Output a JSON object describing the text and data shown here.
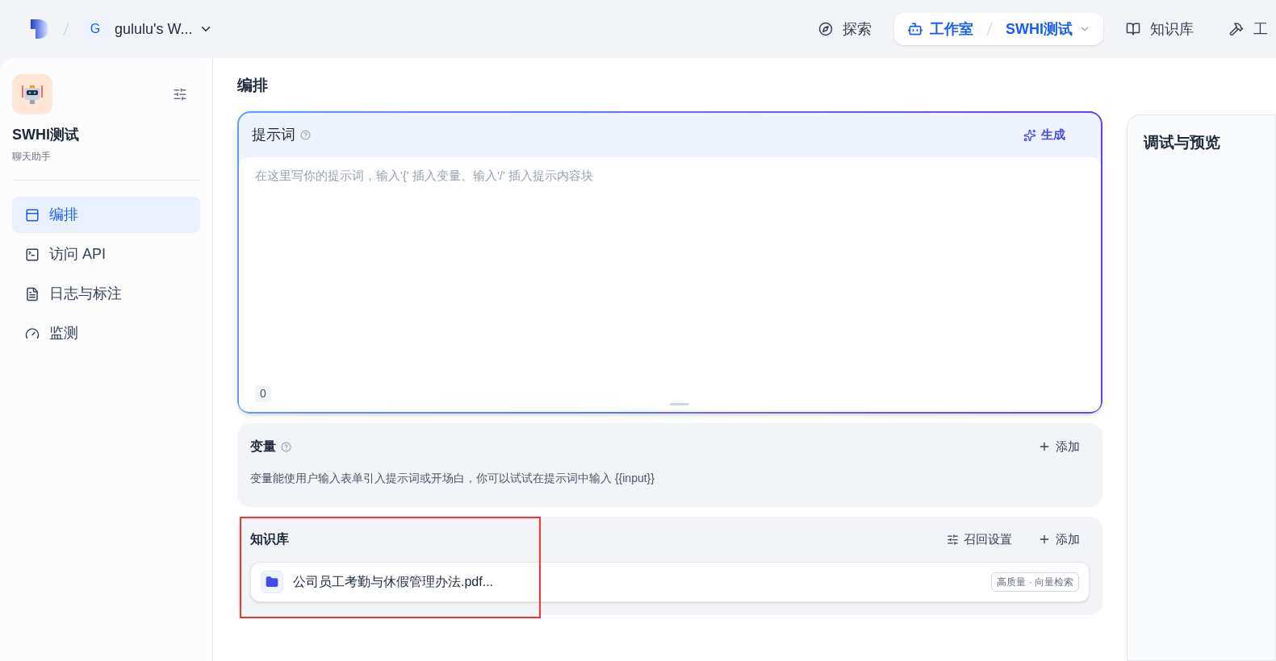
{
  "topbar": {
    "workspace_initial": "G",
    "workspace_name": "gululu's W...",
    "nav": [
      {
        "kind": "link",
        "label": "探索",
        "selected": false
      },
      {
        "kind": "crumb",
        "label": "工作室",
        "app": "SWHI测试",
        "selected": true
      },
      {
        "kind": "link",
        "label": "知识库",
        "selected": false
      },
      {
        "kind": "link",
        "label": "工",
        "selected": false
      }
    ]
  },
  "sidebar": {
    "app_name": "SWHI测试",
    "app_type": "聊天助手",
    "items": [
      {
        "label": "编排",
        "selected": true
      },
      {
        "label": "访问 API",
        "selected": false
      },
      {
        "label": "日志与标注",
        "selected": false
      },
      {
        "label": "监测",
        "selected": false
      }
    ]
  },
  "page_title": "编排",
  "prompt": {
    "title": "提示词",
    "generate": "生成",
    "placeholder": "在这里写你的提示词，输入'{' 插入变量、输入'/' 插入提示内容块",
    "count": "0"
  },
  "variables": {
    "title": "变量",
    "add": "添加",
    "hint": "变量能使用户输入表单引入提示词或开场白，你可以试试在提示词中输入 {{input}}"
  },
  "knowledge": {
    "title": "知识库",
    "highlighted": true,
    "settings": "召回设置",
    "add": "添加",
    "items": [
      {
        "name": "公司员工考勤与休假管理办法.pdf...",
        "tag": "高质量 · 向量检索"
      }
    ]
  },
  "preview": {
    "title": "调试与预览"
  }
}
